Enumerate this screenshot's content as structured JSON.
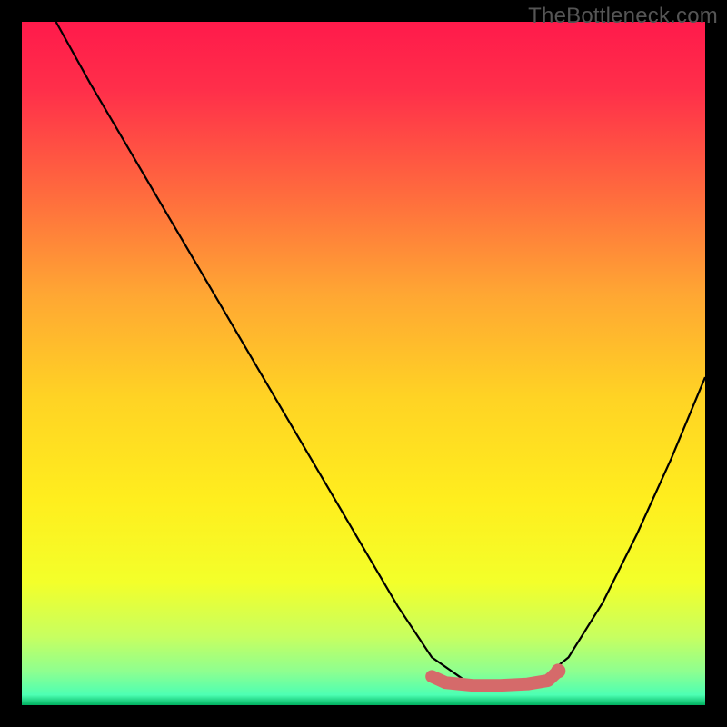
{
  "watermark": "TheBottleneck.com",
  "chart_data": {
    "type": "line",
    "title": "",
    "xlabel": "",
    "ylabel": "",
    "xlim": [
      0,
      100
    ],
    "ylim": [
      0,
      100
    ],
    "grid": false,
    "legend": false,
    "background_gradient": {
      "stops": [
        {
          "offset": 0.0,
          "color": "#ff1a4b"
        },
        {
          "offset": 0.1,
          "color": "#ff2f4a"
        },
        {
          "offset": 0.25,
          "color": "#ff6a3e"
        },
        {
          "offset": 0.4,
          "color": "#ffa733"
        },
        {
          "offset": 0.55,
          "color": "#ffd324"
        },
        {
          "offset": 0.7,
          "color": "#ffee1e"
        },
        {
          "offset": 0.82,
          "color": "#f3ff2a"
        },
        {
          "offset": 0.9,
          "color": "#c7ff60"
        },
        {
          "offset": 0.95,
          "color": "#8fff8f"
        },
        {
          "offset": 0.985,
          "color": "#4dffb3"
        },
        {
          "offset": 1.0,
          "color": "#00b060"
        }
      ]
    },
    "series": [
      {
        "name": "bottleneck-curve",
        "color": "#000000",
        "x": [
          5,
          10,
          15,
          20,
          25,
          30,
          35,
          40,
          45,
          50,
          55,
          60,
          65,
          70,
          75,
          80,
          85,
          90,
          95,
          100
        ],
        "y": [
          100,
          91,
          82.5,
          74,
          65.5,
          57,
          48.5,
          40,
          31.5,
          23,
          14.5,
          7,
          3.5,
          2.5,
          3.0,
          7,
          15,
          25,
          36,
          48
        ]
      },
      {
        "name": "optimal-band",
        "color": "#d56a6a",
        "type": "area",
        "x": [
          60,
          62,
          66,
          70,
          74,
          77,
          78.5
        ],
        "y": [
          4.2,
          3.3,
          2.9,
          2.9,
          3.1,
          3.6,
          5.0
        ]
      }
    ],
    "markers": [
      {
        "name": "optimal-end-dot",
        "x": 78.5,
        "y": 5.0,
        "color": "#d56a6a",
        "size": 8
      }
    ]
  }
}
